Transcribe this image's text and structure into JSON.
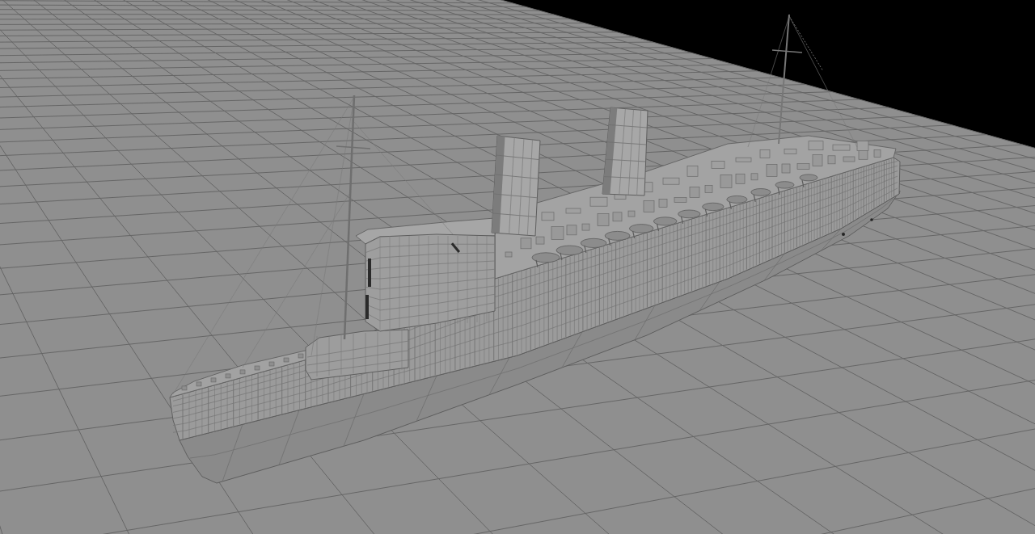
{
  "viewport": {
    "grid": {
      "visible": true
    },
    "objects": [
      {
        "kind": "ship"
      }
    ]
  }
}
